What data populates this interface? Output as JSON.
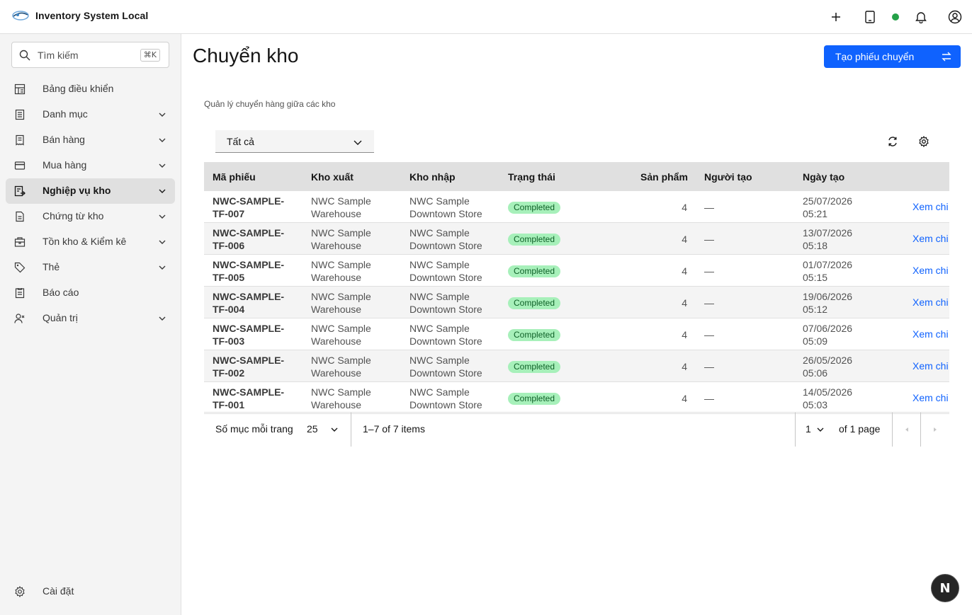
{
  "app": {
    "title": "Inventory System Local",
    "accent_color": "#0f62fe",
    "status_color": "#24a148"
  },
  "header": {
    "icons": [
      "add-icon",
      "tablet-icon",
      "status-dot",
      "notification-icon",
      "user-avatar-icon"
    ]
  },
  "sidebar": {
    "search": {
      "placeholder": "Tìm kiếm",
      "shortcut": "⌘K"
    },
    "items": [
      {
        "label": "Bảng điều khiển",
        "icon": "dashboard-icon",
        "expandable": false,
        "active": false
      },
      {
        "label": "Danh mục",
        "icon": "catalog-icon",
        "expandable": true,
        "active": false
      },
      {
        "label": "Bán hàng",
        "icon": "receipt-icon",
        "expandable": true,
        "active": false
      },
      {
        "label": "Mua hàng",
        "icon": "credit-card-icon",
        "expandable": true,
        "active": false
      },
      {
        "label": "Nghiệp vụ kho",
        "icon": "warehouse-ops-icon",
        "expandable": true,
        "active": true
      },
      {
        "label": "Chứng từ kho",
        "icon": "document-icon",
        "expandable": true,
        "active": false
      },
      {
        "label": "Tồn kho & Kiểm kê",
        "icon": "inventory-icon",
        "expandable": true,
        "active": false
      },
      {
        "label": "Thẻ",
        "icon": "tag-icon",
        "expandable": true,
        "active": false
      },
      {
        "label": "Báo cáo",
        "icon": "report-icon",
        "expandable": false,
        "active": false
      },
      {
        "label": "Quản trị",
        "icon": "admin-icon",
        "expandable": true,
        "active": false
      }
    ],
    "settings_label": "Cài đặt"
  },
  "main": {
    "title": "Chuyển kho",
    "primary_button": "Tạo phiếu chuyển",
    "subtitle": "Quản lý chuyển hàng giữa các kho",
    "filter": {
      "selected": "Tất cả"
    },
    "table": {
      "columns": [
        "Mã phiếu",
        "Kho xuất",
        "Kho nhập",
        "Trạng thái",
        "Sản phẩm",
        "Người tạo",
        "Ngày tạo"
      ],
      "rows": [
        {
          "code1": "NWC-SAMPLE-",
          "code2": "TF-007",
          "from1": "NWC Sample",
          "from2": "Warehouse",
          "to1": "NWC Sample",
          "to2": "Downtown Store",
          "status": "Completed",
          "products": "4",
          "creator": "—",
          "date": "25/07/2026",
          "time": "05:21",
          "action": "Xem chi"
        },
        {
          "code1": "NWC-SAMPLE-",
          "code2": "TF-006",
          "from1": "NWC Sample",
          "from2": "Warehouse",
          "to1": "NWC Sample",
          "to2": "Downtown Store",
          "status": "Completed",
          "products": "4",
          "creator": "—",
          "date": "13/07/2026",
          "time": "05:18",
          "action": "Xem chi"
        },
        {
          "code1": "NWC-SAMPLE-",
          "code2": "TF-005",
          "from1": "NWC Sample",
          "from2": "Warehouse",
          "to1": "NWC Sample",
          "to2": "Downtown Store",
          "status": "Completed",
          "products": "4",
          "creator": "—",
          "date": "01/07/2026",
          "time": "05:15",
          "action": "Xem chi"
        },
        {
          "code1": "NWC-SAMPLE-",
          "code2": "TF-004",
          "from1": "NWC Sample",
          "from2": "Warehouse",
          "to1": "NWC Sample",
          "to2": "Downtown Store",
          "status": "Completed",
          "products": "4",
          "creator": "—",
          "date": "19/06/2026",
          "time": "05:12",
          "action": "Xem chi"
        },
        {
          "code1": "NWC-SAMPLE-",
          "code2": "TF-003",
          "from1": "NWC Sample",
          "from2": "Warehouse",
          "to1": "NWC Sample",
          "to2": "Downtown Store",
          "status": "Completed",
          "products": "4",
          "creator": "—",
          "date": "07/06/2026",
          "time": "05:09",
          "action": "Xem chi"
        },
        {
          "code1": "NWC-SAMPLE-",
          "code2": "TF-002",
          "from1": "NWC Sample",
          "from2": "Warehouse",
          "to1": "NWC Sample",
          "to2": "Downtown Store",
          "status": "Completed",
          "products": "4",
          "creator": "—",
          "date": "26/05/2026",
          "time": "05:06",
          "action": "Xem chi"
        },
        {
          "code1": "NWC-SAMPLE-",
          "code2": "TF-001",
          "from1": "NWC Sample",
          "from2": "Warehouse",
          "to1": "NWC Sample",
          "to2": "Downtown Store",
          "status": "Completed",
          "products": "4",
          "creator": "—",
          "date": "14/05/2026",
          "time": "05:03",
          "action": "Xem chi"
        }
      ]
    },
    "pagination": {
      "per_page_label": "Số mục mỗi trang",
      "per_page": "25",
      "range": "1–7 of 7 items",
      "current_page": "1",
      "total_pages": "of 1 page"
    }
  },
  "fab": {
    "label": "N"
  }
}
